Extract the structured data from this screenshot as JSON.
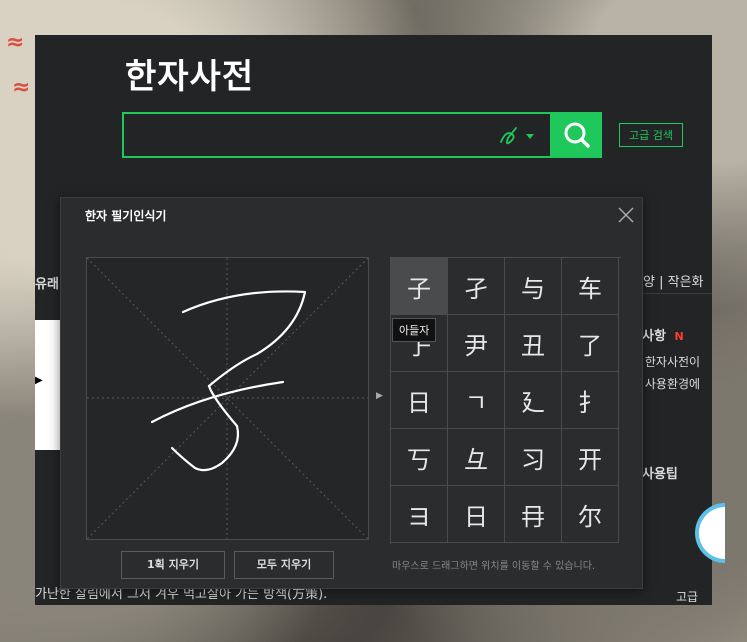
{
  "site": {
    "title": "한자사전",
    "search_placeholder": "",
    "advanced_label": "고급 검색"
  },
  "background_page": {
    "left_tab": "유래",
    "right_tabs": "양 | 작은화",
    "notice_title": "사항",
    "notice_badge": "N",
    "notice_lines": [
      "| 한자사전이",
      "| 사용환경에"
    ],
    "tips_title": "사용팁",
    "bottom_sentence": "가난한 살림에서 그저 겨우 먹고살아 가는 방책(方策).",
    "corner_text": "고급"
  },
  "dialog": {
    "title": "한자 필기인식기",
    "candidates": [
      "子",
      "孑",
      "与",
      "车",
      "孒",
      "尹",
      "丑",
      "了",
      "日",
      "ㄱ",
      "廴",
      "扌",
      "丂",
      "彑",
      "习",
      "开",
      "ヨ",
      "日",
      "冄",
      "尔"
    ],
    "selected_index": 0,
    "tooltip": "아들자",
    "clear_one_label": "1획 지우기",
    "clear_all_label": "모두 지우기",
    "hint": "마우스로 드래그하면 위치를 이동할 수 있습니다."
  },
  "colors": {
    "accent": "#1fc85a",
    "panel": "#232425",
    "dialog": "#2b2c2e",
    "badge": "#ff3b3b"
  },
  "icons": {
    "search": "magnifier-icon",
    "handwriting": "pen-icon",
    "close": "close-icon"
  }
}
